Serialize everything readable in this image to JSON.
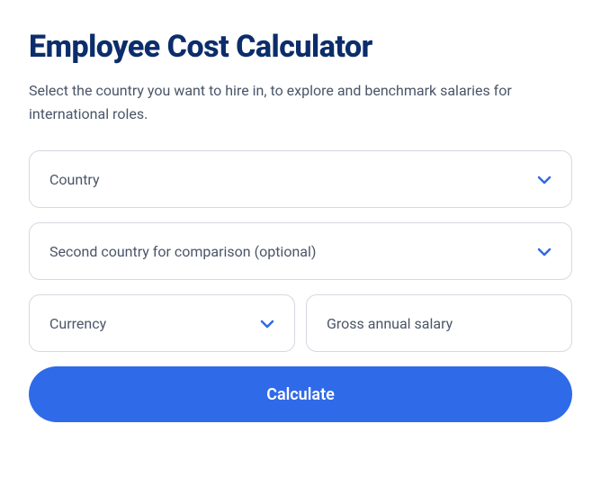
{
  "title": "Employee Cost Calculator",
  "description": "Select the country you want to hire in, to explore and benchmark salaries for international roles.",
  "fields": {
    "country": {
      "label": "Country"
    },
    "secondCountry": {
      "label": "Second country for comparison (optional)"
    },
    "currency": {
      "label": "Currency"
    },
    "salary": {
      "placeholder": "Gross annual salary"
    }
  },
  "button": {
    "calculate": "Calculate"
  },
  "colors": {
    "accent": "#2f6ae8",
    "titleColor": "#0c2d6b"
  }
}
